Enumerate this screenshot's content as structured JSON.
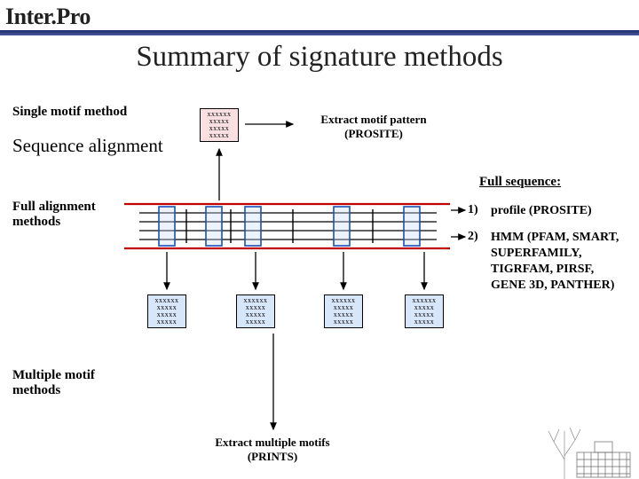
{
  "logo": "Inter.Pro",
  "title": "Summary of signature methods",
  "labels": {
    "single_motif": "Single motif method",
    "seq_align": "Sequence alignment",
    "extract_pattern_l1": "Extract motif pattern",
    "extract_pattern_l2": "(PROSITE)",
    "full_sequence": "Full sequence:",
    "full_align_l1": "Full alignment",
    "full_align_l2": "methods",
    "multiple_l1": "Multiple motif",
    "multiple_l2": "methods",
    "extract_multi_l1": "Extract multiple motifs",
    "extract_multi_l2": "(PRINTS)"
  },
  "list": {
    "n1": "1)",
    "n2": "2)",
    "item1": "profile (PROSITE)",
    "item2": "HMM (PFAM, SMART, SUPERFAMILY, TIGRFAM, PIRSF, GENE 3D, PANTHER)"
  },
  "motif": {
    "l1": "xxxxxx",
    "l2": "xxxxx",
    "l3": "xxxxx",
    "l4": "xxxxx"
  },
  "colors": {
    "accent_blue": "#1a4fb8",
    "accent_red": "#c00000"
  }
}
